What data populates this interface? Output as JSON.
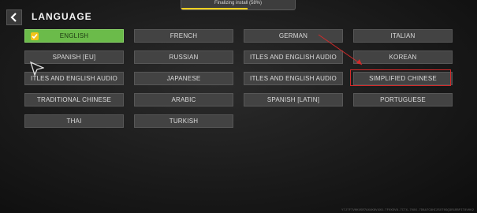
{
  "header": {
    "title": "LANGUAGE",
    "progress_text": "Finalizing install (58%)",
    "progress_fraction": 0.58
  },
  "languages": [
    {
      "label": "ENGLISH",
      "selected": true
    },
    {
      "label": "FRENCH",
      "selected": false
    },
    {
      "label": "GERMAN",
      "selected": false
    },
    {
      "label": "ITALIAN",
      "selected": false
    },
    {
      "label": "SPANISH [EU]",
      "selected": false
    },
    {
      "label": "RUSSIAN",
      "selected": false
    },
    {
      "label": "ITLES AND ENGLISH AUDIO",
      "selected": false
    },
    {
      "label": "KOREAN",
      "selected": false
    },
    {
      "label": "ITLES AND ENGLISH AUDIO",
      "selected": false
    },
    {
      "label": "JAPANESE",
      "selected": false
    },
    {
      "label": "ITLES AND ENGLISH AUDIO",
      "selected": false
    },
    {
      "label": "SIMPLIFIED CHINESE",
      "selected": false
    },
    {
      "label": "TRADITIONAL CHINESE",
      "selected": false
    },
    {
      "label": "ARABIC",
      "selected": false
    },
    {
      "label": "SPANISH [LATIN]",
      "selected": false
    },
    {
      "label": "PORTUGUESE",
      "selected": false
    },
    {
      "label": "THAI",
      "selected": false
    },
    {
      "label": "TURKISH",
      "selected": false
    }
  ],
  "annotation": {
    "highlighted": "SIMPLIFIED CHINESE",
    "color": "#d22a2a"
  },
  "colors": {
    "selected": "#6bbb4a",
    "button": "#434343",
    "progress": "#f5d020"
  },
  "footer": {
    "text": "Y7J7F7V0KU5R7AX4K8V4X9-7F0XDV8-7C7X-7V8X-7D8A7C8HI2SXT0GQ3R1RBPIT8V0K2"
  }
}
